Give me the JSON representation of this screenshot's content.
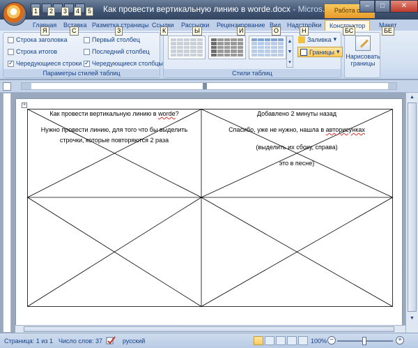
{
  "window": {
    "title": "Как провести вертикальную линию в worde.docx",
    "app_suffix": " - Micros...",
    "context_tab_group": "Работа с...",
    "minimize": "–",
    "maximize": "□",
    "close": "✕"
  },
  "quick_access_keytips": [
    "1",
    "2",
    "3",
    "4",
    "5"
  ],
  "tabs": [
    {
      "label": "Главная",
      "keytip": "Я"
    },
    {
      "label": "Вставка",
      "keytip": "С"
    },
    {
      "label": "Разметка страницы",
      "keytip": "З"
    },
    {
      "label": "Ссылки",
      "keytip": "К"
    },
    {
      "label": "Рассылки",
      "keytip": "Ы"
    },
    {
      "label": "Рецензирование",
      "keytip": "И"
    },
    {
      "label": "Вид",
      "keytip": "О"
    },
    {
      "label": "Надстройки",
      "keytip": "Н"
    },
    {
      "label": "Конструктор",
      "keytip": "БС"
    },
    {
      "label": "Макет",
      "keytip": "БЕ"
    }
  ],
  "ribbon": {
    "style_options": {
      "label": "Параметры стилей таблиц",
      "items": [
        {
          "label": "Строка заголовка",
          "checked": false
        },
        {
          "label": "Строка итогов",
          "checked": false
        },
        {
          "label": "Чередующиеся строки",
          "checked": true
        },
        {
          "label": "Первый столбец",
          "checked": false
        },
        {
          "label": "Последний столбец",
          "checked": false
        },
        {
          "label": "Чередующиеся столбцы",
          "checked": true
        }
      ]
    },
    "table_styles": {
      "label": "Стили таблиц",
      "fill_label": "Заливка",
      "borders_label": "Границы"
    },
    "draw": {
      "label": "Нарисовать границы"
    }
  },
  "document": {
    "cell_1": {
      "line1_pre": "Как провести вертикальную линию в ",
      "line1_word": "worde",
      "line1_post": "?",
      "line2": "Нужно провести линию, для того что бы выделить",
      "line3": "строчки, которые повторяются 2 раза"
    },
    "cell_2": {
      "line1": "Добавлено 2 минуты назад",
      "line2_pre": "Спасибо, уже не нужно, нашла в ",
      "line2_word": "авторисунках",
      "line3": "(выделить их сбоку, справа)",
      "line4": "это в песне)"
    }
  },
  "statusbar": {
    "page": "Страница: 1 из 1",
    "words": "Число слов: 37",
    "language": "русский",
    "zoom": "100%"
  }
}
